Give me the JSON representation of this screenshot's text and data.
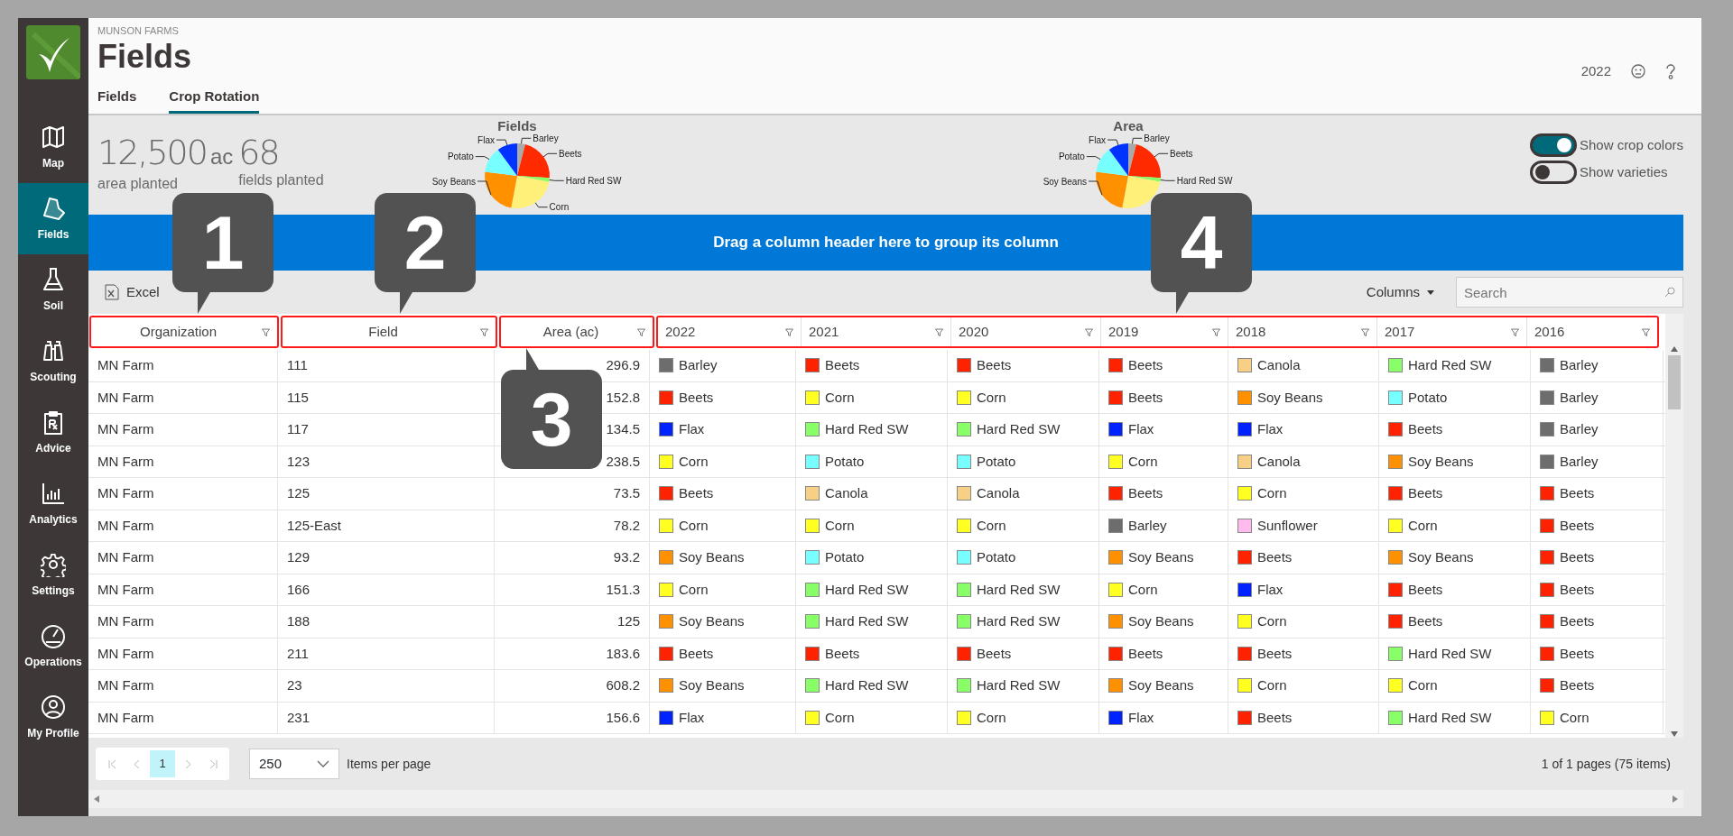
{
  "header": {
    "company": "MUNSON FARMS",
    "title": "Fields",
    "year": "2022"
  },
  "sidebar": {
    "items": [
      {
        "label": "Map",
        "selected": false
      },
      {
        "label": "Fields",
        "selected": true
      },
      {
        "label": "Soil",
        "selected": false
      },
      {
        "label": "Scouting",
        "selected": false
      },
      {
        "label": "Advice",
        "selected": false
      },
      {
        "label": "Analytics",
        "selected": false
      },
      {
        "label": "Settings",
        "selected": false
      },
      {
        "label": "Operations",
        "selected": false
      },
      {
        "label": "My Profile",
        "selected": false
      }
    ]
  },
  "tabs": [
    {
      "label": "Fields",
      "selected": false
    },
    {
      "label": "Crop Rotation",
      "selected": true
    }
  ],
  "stats": [
    {
      "value": "12,500",
      "unit": "ac",
      "label": "area planted"
    },
    {
      "value": "68",
      "label": "fields planted"
    }
  ],
  "pies": [
    {
      "title": "Fields",
      "slices": [
        {
          "label": "Barley",
          "color": "#aaaaaa"
        },
        {
          "label": "Beets",
          "color": "#ff2a00"
        },
        {
          "label": "Hard Red SW",
          "color": "#88ff66"
        },
        {
          "label": "Corn",
          "color": "#fff07a"
        },
        {
          "label": "Soy Beans",
          "color": "#ff9000"
        },
        {
          "label": "Potato",
          "color": "#77ffff"
        },
        {
          "label": "Flax",
          "color": "#0033ff"
        }
      ]
    },
    {
      "title": "Area",
      "slices": [
        {
          "label": "Barley",
          "color": "#aaaaaa"
        },
        {
          "label": "Beets",
          "color": "#ff2a00"
        },
        {
          "label": "Hard Red SW",
          "color": "#88ff66"
        },
        {
          "color": "#fff07a"
        },
        {
          "label": "Soy Beans",
          "color": "#ff9000"
        },
        {
          "label": "Potato",
          "color": "#77ffff"
        },
        {
          "label": "Flax",
          "color": "#0033ff"
        }
      ]
    }
  ],
  "toggles": [
    {
      "label": "Show crop colors",
      "on": true
    },
    {
      "label": "Show varieties",
      "on": false
    }
  ],
  "group_bar": "Drag a column header here to group its column",
  "toolbar": {
    "export": "Excel",
    "columns": "Columns",
    "search_placeholder": "Search"
  },
  "header_groups": [
    {
      "callout": "1",
      "columns": [
        {
          "label": "Organization"
        }
      ]
    },
    {
      "callout": "2",
      "columns": [
        {
          "label": "Field"
        }
      ]
    },
    {
      "callout": "3",
      "columns": [
        {
          "label": "Area (ac)"
        }
      ]
    },
    {
      "callout": "4",
      "columns": [
        {
          "label": "2022"
        },
        {
          "label": "2021"
        },
        {
          "label": "2020"
        },
        {
          "label": "2019"
        },
        {
          "label": "2018"
        },
        {
          "label": "2017"
        },
        {
          "label": "2016"
        }
      ]
    }
  ],
  "rows": [
    {
      "organization": "MN Farm",
      "field": "111",
      "area": "296.9",
      "crops": [
        {
          "crop": "Barley",
          "color": "#6d6d6d"
        },
        {
          "crop": "Beets",
          "color": "#ff2200"
        },
        {
          "crop": "Beets",
          "color": "#ff2200"
        },
        {
          "crop": "Beets",
          "color": "#ff2200"
        },
        {
          "crop": "Canola",
          "color": "#f7cf85"
        },
        {
          "crop": "Hard Red SW",
          "color": "#88ff66"
        },
        {
          "crop": "Barley",
          "color": "#6d6d6d"
        }
      ]
    },
    {
      "organization": "MN Farm",
      "field": "115",
      "area": "152.8",
      "crops": [
        {
          "crop": "Beets",
          "color": "#ff2200"
        },
        {
          "crop": "Corn",
          "color": "#ffff22"
        },
        {
          "crop": "Corn",
          "color": "#ffff22"
        },
        {
          "crop": "Beets",
          "color": "#ff2200"
        },
        {
          "crop": "Soy Beans",
          "color": "#ff9000"
        },
        {
          "crop": "Potato",
          "color": "#77ffff"
        },
        {
          "crop": "Barley",
          "color": "#6d6d6d"
        }
      ]
    },
    {
      "organization": "MN Farm",
      "field": "117",
      "area": "134.5",
      "crops": [
        {
          "crop": "Flax",
          "color": "#0022ff"
        },
        {
          "crop": "Hard Red SW",
          "color": "#88ff66"
        },
        {
          "crop": "Hard Red SW",
          "color": "#88ff66"
        },
        {
          "crop": "Flax",
          "color": "#0022ff"
        },
        {
          "crop": "Flax",
          "color": "#0022ff"
        },
        {
          "crop": "Beets",
          "color": "#ff2200"
        },
        {
          "crop": "Barley",
          "color": "#6d6d6d"
        }
      ]
    },
    {
      "organization": "MN Farm",
      "field": "123",
      "area": "238.5",
      "crops": [
        {
          "crop": "Corn",
          "color": "#ffff22"
        },
        {
          "crop": "Potato",
          "color": "#77ffff"
        },
        {
          "crop": "Potato",
          "color": "#77ffff"
        },
        {
          "crop": "Corn",
          "color": "#ffff22"
        },
        {
          "crop": "Canola",
          "color": "#f7cf85"
        },
        {
          "crop": "Soy Beans",
          "color": "#ff9000"
        },
        {
          "crop": "Barley",
          "color": "#6d6d6d"
        }
      ]
    },
    {
      "organization": "MN Farm",
      "field": "125",
      "area": "73.5",
      "crops": [
        {
          "crop": "Beets",
          "color": "#ff2200"
        },
        {
          "crop": "Canola",
          "color": "#f7cf85"
        },
        {
          "crop": "Canola",
          "color": "#f7cf85"
        },
        {
          "crop": "Beets",
          "color": "#ff2200"
        },
        {
          "crop": "Corn",
          "color": "#ffff22"
        },
        {
          "crop": "Beets",
          "color": "#ff2200"
        },
        {
          "crop": "Beets",
          "color": "#ff2200"
        }
      ]
    },
    {
      "organization": "MN Farm",
      "field": "125-East",
      "area": "78.2",
      "crops": [
        {
          "crop": "Corn",
          "color": "#ffff22"
        },
        {
          "crop": "Corn",
          "color": "#ffff22"
        },
        {
          "crop": "Corn",
          "color": "#ffff22"
        },
        {
          "crop": "Barley",
          "color": "#6d6d6d"
        },
        {
          "crop": "Sunflower",
          "color": "#ffbbee"
        },
        {
          "crop": "Corn",
          "color": "#ffff22"
        },
        {
          "crop": "Beets",
          "color": "#ff2200"
        }
      ]
    },
    {
      "organization": "MN Farm",
      "field": "129",
      "area": "93.2",
      "crops": [
        {
          "crop": "Soy Beans",
          "color": "#ff9000"
        },
        {
          "crop": "Potato",
          "color": "#77ffff"
        },
        {
          "crop": "Potato",
          "color": "#77ffff"
        },
        {
          "crop": "Soy Beans",
          "color": "#ff9000"
        },
        {
          "crop": "Beets",
          "color": "#ff2200"
        },
        {
          "crop": "Soy Beans",
          "color": "#ff9000"
        },
        {
          "crop": "Beets",
          "color": "#ff2200"
        }
      ]
    },
    {
      "organization": "MN Farm",
      "field": "166",
      "area": "151.3",
      "crops": [
        {
          "crop": "Corn",
          "color": "#ffff22"
        },
        {
          "crop": "Hard Red SW",
          "color": "#88ff66"
        },
        {
          "crop": "Hard Red SW",
          "color": "#88ff66"
        },
        {
          "crop": "Corn",
          "color": "#ffff22"
        },
        {
          "crop": "Flax",
          "color": "#0022ff"
        },
        {
          "crop": "Beets",
          "color": "#ff2200"
        },
        {
          "crop": "Beets",
          "color": "#ff2200"
        }
      ]
    },
    {
      "organization": "MN Farm",
      "field": "188",
      "area": "125",
      "crops": [
        {
          "crop": "Soy Beans",
          "color": "#ff9000"
        },
        {
          "crop": "Hard Red SW",
          "color": "#88ff66"
        },
        {
          "crop": "Hard Red SW",
          "color": "#88ff66"
        },
        {
          "crop": "Soy Beans",
          "color": "#ff9000"
        },
        {
          "crop": "Corn",
          "color": "#ffff22"
        },
        {
          "crop": "Beets",
          "color": "#ff2200"
        },
        {
          "crop": "Beets",
          "color": "#ff2200"
        }
      ]
    },
    {
      "organization": "MN Farm",
      "field": "211",
      "area": "183.6",
      "crops": [
        {
          "crop": "Beets",
          "color": "#ff2200"
        },
        {
          "crop": "Beets",
          "color": "#ff2200"
        },
        {
          "crop": "Beets",
          "color": "#ff2200"
        },
        {
          "crop": "Beets",
          "color": "#ff2200"
        },
        {
          "crop": "Beets",
          "color": "#ff2200"
        },
        {
          "crop": "Hard Red SW",
          "color": "#88ff66"
        },
        {
          "crop": "Beets",
          "color": "#ff2200"
        }
      ]
    },
    {
      "organization": "MN Farm",
      "field": "23",
      "area": "608.2",
      "crops": [
        {
          "crop": "Soy Beans",
          "color": "#ff9000"
        },
        {
          "crop": "Hard Red SW",
          "color": "#88ff66"
        },
        {
          "crop": "Hard Red SW",
          "color": "#88ff66"
        },
        {
          "crop": "Soy Beans",
          "color": "#ff9000"
        },
        {
          "crop": "Corn",
          "color": "#ffff22"
        },
        {
          "crop": "Corn",
          "color": "#ffff22"
        },
        {
          "crop": "Beets",
          "color": "#ff2200"
        }
      ]
    },
    {
      "organization": "MN Farm",
      "field": "231",
      "area": "156.6",
      "crops": [
        {
          "crop": "Flax",
          "color": "#0022ff"
        },
        {
          "crop": "Corn",
          "color": "#ffff22"
        },
        {
          "crop": "Corn",
          "color": "#ffff22"
        },
        {
          "crop": "Flax",
          "color": "#0022ff"
        },
        {
          "crop": "Beets",
          "color": "#ff2200"
        },
        {
          "crop": "Hard Red SW",
          "color": "#88ff66"
        },
        {
          "crop": "Corn",
          "color": "#ffff22"
        }
      ]
    }
  ],
  "pager": {
    "pages": [
      {
        "label": "1",
        "selected": true
      }
    ],
    "page_size": "250",
    "page_size_label": "Items per page",
    "summary": "1 of 1 pages (75 items)"
  }
}
